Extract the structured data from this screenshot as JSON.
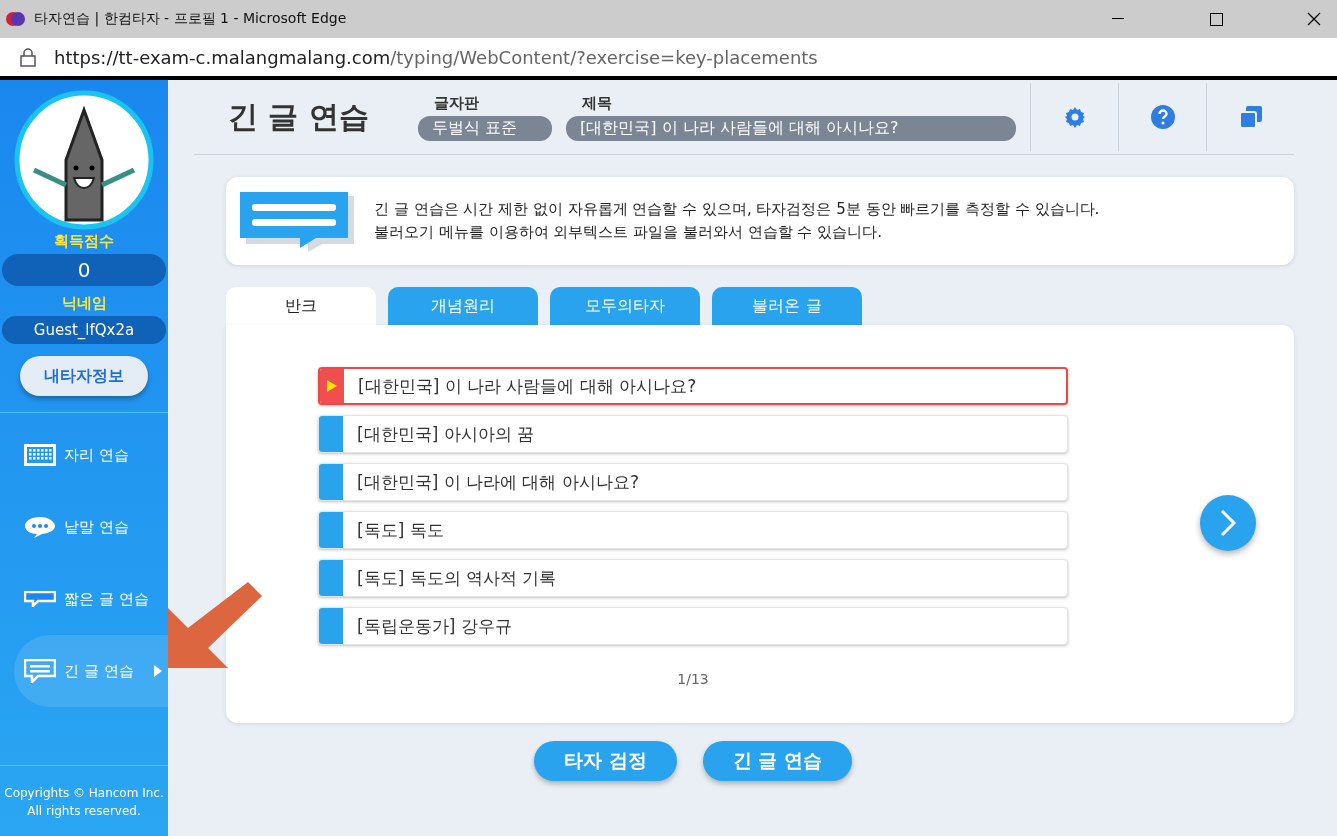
{
  "window": {
    "title": "타자연습 | 한컴타자 - 프로필 1 - Microsoft Edge"
  },
  "address_bar": {
    "url_host": "https://tt-exam-c.malangmalang.com",
    "url_path": "/typing/WebContent/?exercise=key-placements"
  },
  "sidebar": {
    "score_label": "획득점수",
    "score": "0",
    "nickname_label": "닉네임",
    "nickname": "Guest_lfQx2a",
    "profile_button": "내타자정보",
    "items": [
      {
        "kind": "keyboard",
        "label": "자리 연습",
        "selected": false
      },
      {
        "kind": "chat",
        "label": "낱말 연습",
        "selected": false
      },
      {
        "kind": "short",
        "label": "짧은 글 연습",
        "selected": false
      },
      {
        "kind": "long",
        "label": "긴 글 연습",
        "selected": true
      }
    ],
    "copyright": [
      "Copyrights © Hancom Inc.",
      "All rights reserved."
    ]
  },
  "header": {
    "title": "긴 글 연습",
    "layout_label": "글자판",
    "layout_value": "두벌식 표준",
    "subject_label": "제목",
    "subject_value": "[대한민국] 이 나라 사람들에 대해 아시나요?"
  },
  "info": [
    "긴 글 연습은 시간 제한 없이 자유롭게 연습할 수 있으며, 타자검정은 5분 동안 빠르기를 측정할 수 있습니다.",
    "불러오기 메뉴를 이용하여 외부텍스트 파일을 불러와서 연습할 수 있습니다."
  ],
  "tabs": [
    {
      "label": "반크",
      "selected": true
    },
    {
      "label": "개념원리",
      "selected": false
    },
    {
      "label": "모두의타자",
      "selected": false
    },
    {
      "label": "불러온 글",
      "selected": false
    }
  ],
  "texts": [
    {
      "label": "[대한민국] 이 나라 사람들에 대해 아시나요?",
      "selected": true
    },
    {
      "label": "[대한민국] 아시아의 꿈",
      "selected": false
    },
    {
      "label": "[대한민국] 이 나라에 대해 아시나요?",
      "selected": false
    },
    {
      "label": "[독도] 독도",
      "selected": false
    },
    {
      "label": "[독도] 독도의 역사적 기록",
      "selected": false
    },
    {
      "label": "[독립운동가] 강우규",
      "selected": false
    }
  ],
  "page": "1/13",
  "buttons": [
    "타자 검정",
    "긴 글 연습"
  ]
}
